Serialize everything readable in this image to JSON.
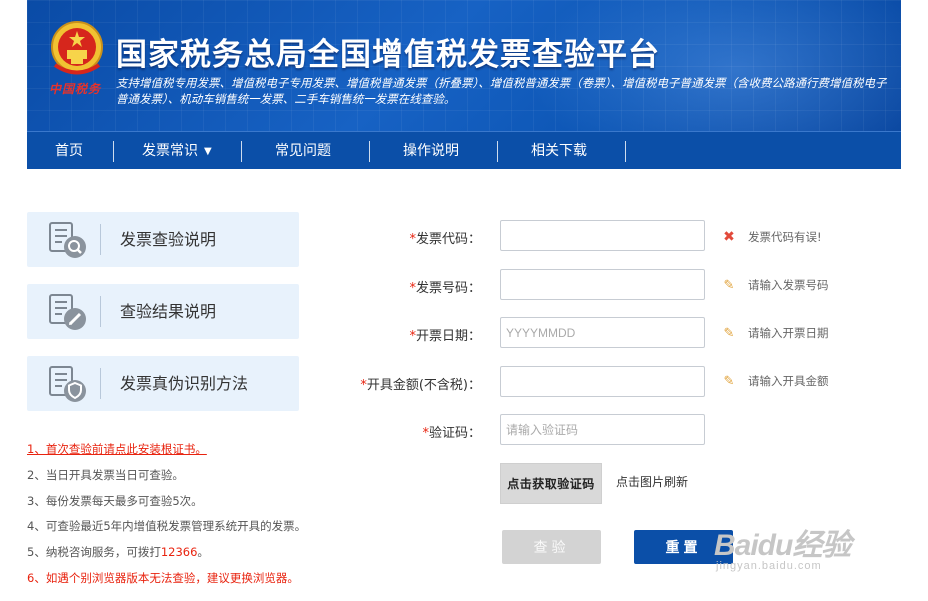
{
  "header": {
    "emblem_text": "中国税务",
    "title": "国家税务总局全国增值税发票查验平台",
    "subtitle": "支持增值税专用发票、增值税电子专用发票、增值税普通发票（折叠票）、增值税普通发票（卷票）、增值税电子普通发票（含收费公路通行费增值税电子普通发票）、机动车销售统一发票、二手车销售统一发票在线查验。"
  },
  "nav": {
    "items": [
      {
        "label": "首页"
      },
      {
        "label": "发票常识",
        "has_dropdown": true
      },
      {
        "label": "常见问题"
      },
      {
        "label": "操作说明"
      },
      {
        "label": "相关下载"
      }
    ]
  },
  "sidebar": {
    "cards": [
      {
        "label": "发票查验说明",
        "icon": "document-search-icon"
      },
      {
        "label": "查验结果说明",
        "icon": "document-edit-icon"
      },
      {
        "label": "发票真伪识别方法",
        "icon": "document-shield-icon"
      }
    ]
  },
  "notes": [
    {
      "text": "1、首次查验前请点此安装根证书。",
      "style": "red-link"
    },
    {
      "text": "2、当日开具发票当日可查验。",
      "style": "normal"
    },
    {
      "text": "3、每份发票每天最多可查验5次。",
      "style": "normal"
    },
    {
      "text": "4、可查验最近5年内增值税发票管理系统开具的发票。",
      "style": "normal"
    },
    {
      "text_prefix": "5、纳税咨询服务，可拨打",
      "phone": "12366",
      "text_suffix": "。",
      "style": "normal"
    },
    {
      "text": "6、如遇个别浏览器版本无法查验，建议更换浏览器。",
      "style": "red"
    }
  ],
  "form": {
    "required_mark": "*",
    "invoice_code": {
      "label": "发票代码：",
      "value": "",
      "placeholder": "",
      "hint": "发票代码有误!",
      "hint_type": "error"
    },
    "invoice_number": {
      "label": "发票号码：",
      "value": "",
      "placeholder": "",
      "hint": "请输入发票号码",
      "hint_type": "edit"
    },
    "issue_date": {
      "label": "开票日期：",
      "value": "",
      "placeholder": "YYYYMMDD",
      "hint": "请输入开票日期",
      "hint_type": "edit"
    },
    "amount": {
      "label": "开具金额(不含税)：",
      "value": "",
      "placeholder": "",
      "hint": "请输入开具金额",
      "hint_type": "edit"
    },
    "captcha": {
      "label": "验证码：",
      "value": "",
      "placeholder": "请输入验证码"
    },
    "captcha_image_text": "点击获取验证码",
    "refresh_text": "点击图片刷新",
    "query_button": "查验",
    "reset_button": "重置"
  },
  "watermark": {
    "main": "Baidu经验",
    "sub": "jingyan.baidu.com"
  },
  "colors": {
    "header_blue": "#0b4fa8",
    "required_red": "#e8230f",
    "error_red": "#e24a3b",
    "card_bg": "#e8f2fc",
    "disabled_gray": "#d3d3d3"
  }
}
